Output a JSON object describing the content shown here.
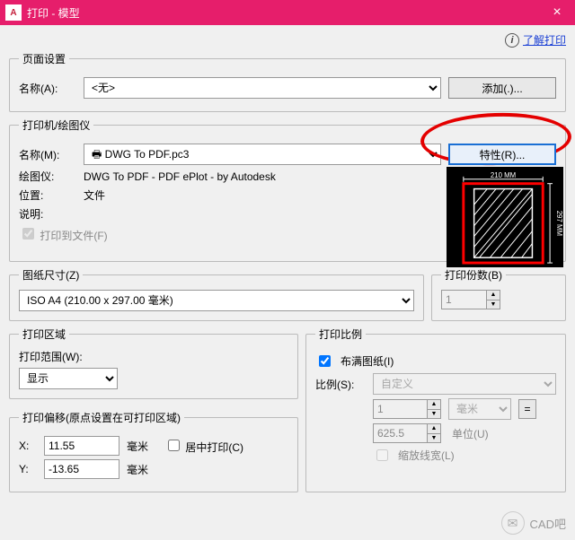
{
  "titlebar": {
    "app_icon": "A",
    "title": "打印 - 模型",
    "close": "×"
  },
  "help": {
    "icon": "i",
    "link": "了解打印"
  },
  "page_setup": {
    "legend": "页面设置",
    "name_label": "名称(A):",
    "name_value": "<无>",
    "add_btn": "添加(.)..."
  },
  "printer": {
    "legend": "打印机/绘图仪",
    "name_label": "名称(M):",
    "name_value": "DWG To PDF.pc3",
    "props_btn": "特性(R)...",
    "plotter_label": "绘图仪:",
    "plotter_value": "DWG To PDF - PDF ePlot - by Autodesk",
    "location_label": "位置:",
    "location_value": "文件",
    "desc_label": "说明:",
    "to_file": "打印到文件(F)",
    "preview_w": "210 MM",
    "preview_h": "297 MM"
  },
  "paper": {
    "legend": "图纸尺寸(Z)",
    "value": "ISO A4 (210.00 x 297.00 毫米)"
  },
  "copies": {
    "legend": "打印份数(B)",
    "value": "1"
  },
  "area": {
    "legend": "打印区域",
    "range_label": "打印范围(W):",
    "range_value": "显示"
  },
  "scale": {
    "legend": "打印比例",
    "fit_label": "布满图纸(I)",
    "ratio_label": "比例(S):",
    "ratio_value": "自定义",
    "num1": "1",
    "unit1": "毫米",
    "eq": "=",
    "num2": "625.5",
    "unit2": "单位(U)",
    "scale_lw": "缩放线宽(L)"
  },
  "offset": {
    "legend": "打印偏移(原点设置在可打印区域)",
    "x_label": "X:",
    "x_value": "11.55",
    "x_unit": "毫米",
    "center": "居中打印(C)",
    "y_label": "Y:",
    "y_value": "-13.65",
    "y_unit": "毫米"
  },
  "watermark": "CAD吧"
}
